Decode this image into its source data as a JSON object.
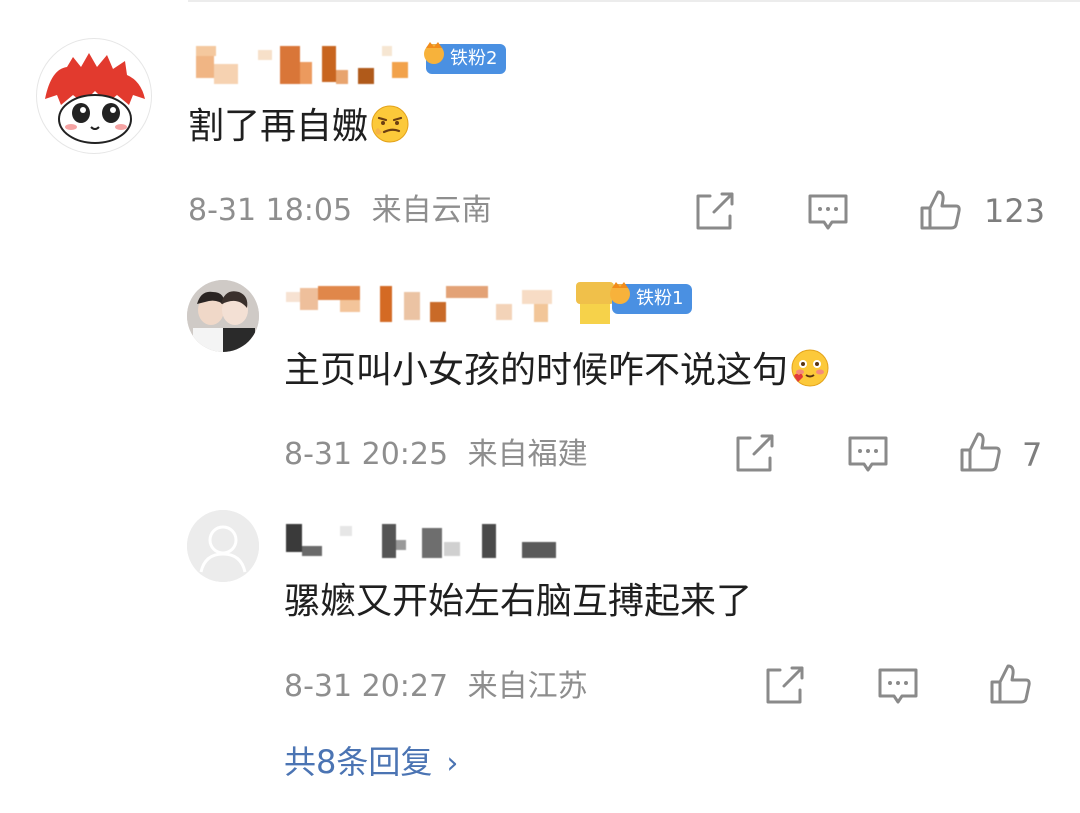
{
  "top_comment": {
    "badge": "铁粉2",
    "text": "割了再自嫐",
    "time": "8-31 18:05",
    "location": "来自云南",
    "likes": "123"
  },
  "replies": [
    {
      "badge": "铁粉1",
      "text": "主页叫小女孩的时候咋不说这句",
      "time": "8-31 20:25",
      "location": "来自福建",
      "likes": "7"
    },
    {
      "text": "骡嬷又开始左右脑互搏起来了",
      "time": "8-31 20:27",
      "location": "来自江苏",
      "likes": ""
    }
  ],
  "more_replies": {
    "label": "共8条回复",
    "chevron": "›"
  },
  "colors": {
    "badge": "#4a90e2",
    "link": "#4b74b3",
    "meta": "#8e8e8e"
  },
  "icons": [
    "repost-icon",
    "comment-icon",
    "like-icon",
    "chevron-right-icon"
  ]
}
